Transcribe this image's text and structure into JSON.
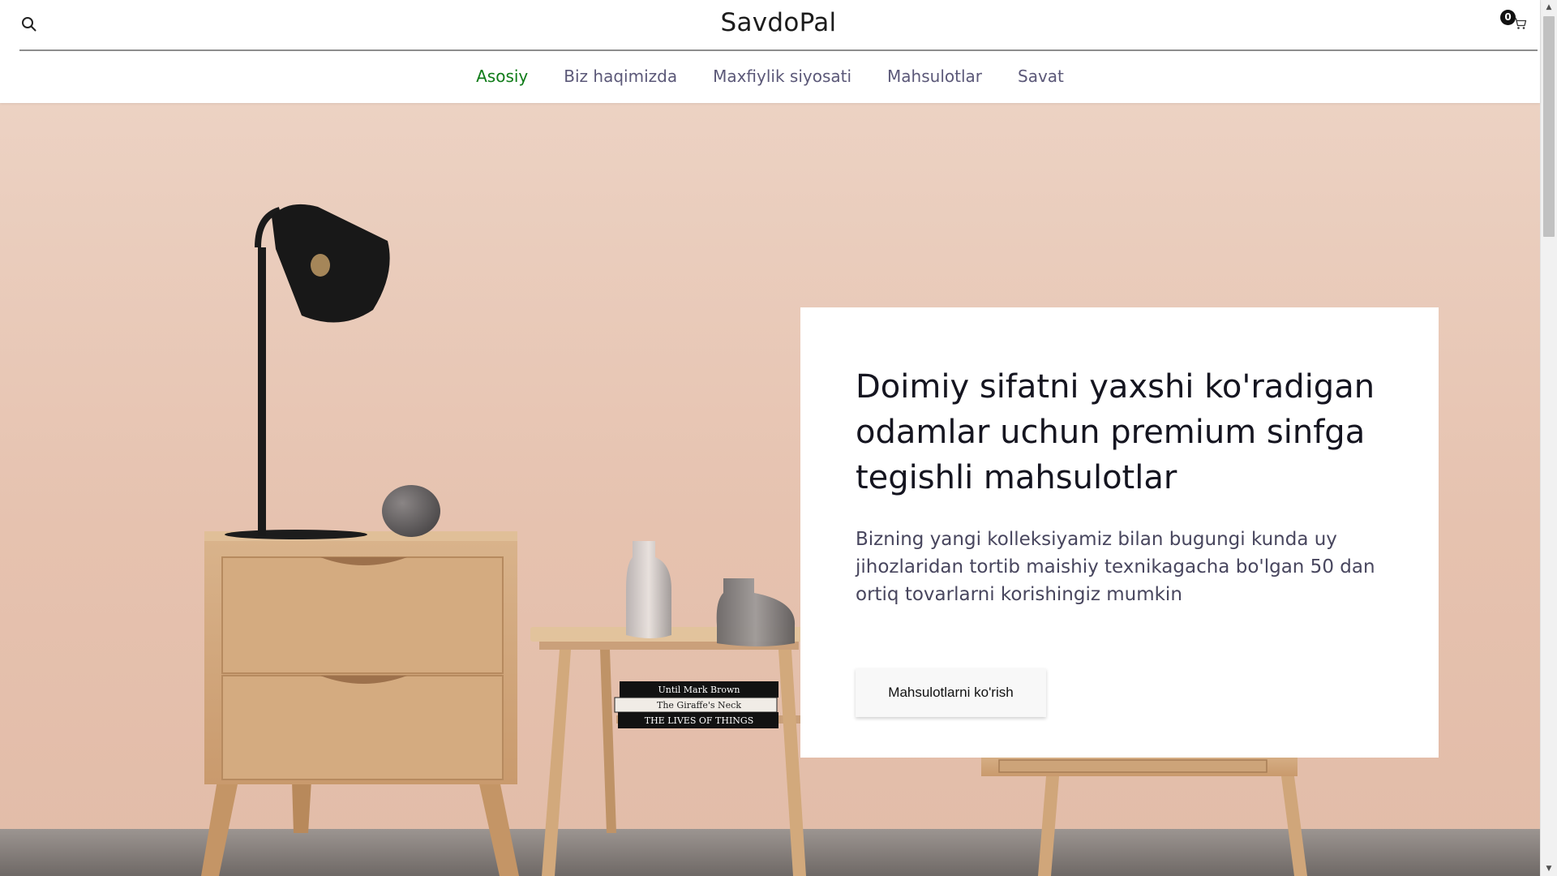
{
  "header": {
    "logo": "SavdoPal",
    "cart_count": "0",
    "icons": {
      "search": "search-icon",
      "cart": "cart-icon"
    }
  },
  "nav": {
    "items": [
      {
        "label": "Asosiy",
        "active": true
      },
      {
        "label": "Biz haqimizda",
        "active": false
      },
      {
        "label": "Maxfiylik siyosati",
        "active": false
      },
      {
        "label": "Mahsulotlar",
        "active": false
      },
      {
        "label": "Savat",
        "active": false
      }
    ]
  },
  "hero": {
    "title": "Doimiy sifatni yaxshi ko'radigan odamlar uchun premium sinfga tegishli mahsulotlar",
    "subtitle": "Bizning yangi kolleksiyamiz bilan bugungi kunda uy jihozlaridan tortib maishiy texnikagacha bo'lgan 50 dan ortiq tovarlarni korishingiz mumkin",
    "cta_label": "Mahsulotlarni ko'rish",
    "books": [
      "Until Mark Brown",
      "The Giraffe's Neck",
      "THE LIVES OF THINGS"
    ]
  },
  "colors": {
    "accent_active_nav": "#0f7b18",
    "nav_text": "#5b5878",
    "hero_background": "#e8c6b4"
  }
}
